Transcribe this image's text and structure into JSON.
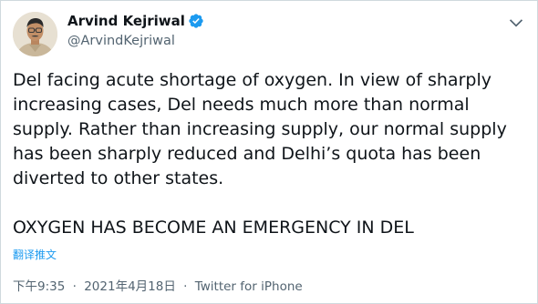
{
  "author": {
    "display_name": "Arvind Kejriwal",
    "handle": "@ArvindKejriwal",
    "verified": true
  },
  "tweet": {
    "paragraph_1": "Del facing acute shortage of oxygen. In view of sharply increasing cases, Del needs much more than normal supply. Rather than increasing supply, our normal supply has been sharply reduced and Delhi’s quota has been diverted to other states.",
    "paragraph_2": "OXYGEN HAS BECOME AN EMERGENCY IN DEL"
  },
  "translate_label": "翻译推文",
  "meta": {
    "time": "下午9:35",
    "separator": "·",
    "date": "2021年4月18日",
    "source": "Twitter for iPhone"
  },
  "colors": {
    "link": "#1d9bf0",
    "verified_badge": "#1d9bf0",
    "secondary_text": "#536471",
    "border": "#cfd9de"
  },
  "icons": {
    "more": "chevron-down-icon",
    "verified": "verified-badge-icon"
  }
}
